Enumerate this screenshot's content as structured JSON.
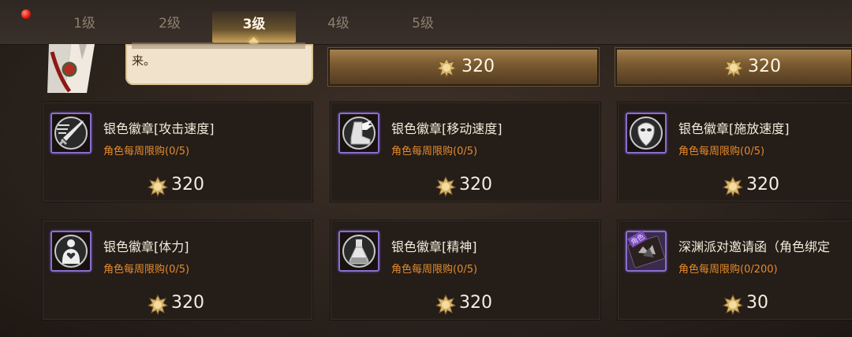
{
  "tabs": [
    {
      "label": "1级"
    },
    {
      "label": "2级"
    },
    {
      "label": "3级",
      "active": true
    },
    {
      "label": "4级"
    },
    {
      "label": "5级"
    }
  ],
  "top_row": {
    "speech_text": "来。",
    "prices": [
      "320",
      "320"
    ]
  },
  "items": [
    {
      "name": "银色徽章[攻击速度]",
      "limit": "角色每周限购(0/5)",
      "price": "320",
      "icon": "sword-speed-icon"
    },
    {
      "name": "银色徽章[移动速度]",
      "limit": "角色每周限购(0/5)",
      "price": "320",
      "icon": "winged-boot-icon"
    },
    {
      "name": "银色徽章[施放速度]",
      "limit": "角色每周限购(0/5)",
      "price": "320",
      "icon": "mask-icon"
    },
    {
      "name": "银色徽章[体力]",
      "limit": "角色每周限购(0/5)",
      "price": "320",
      "icon": "body-heart-icon"
    },
    {
      "name": "银色徽章[精神]",
      "limit": "角色每周限购(0/5)",
      "price": "320",
      "icon": "potion-flask-icon"
    },
    {
      "name": "深渊派对邀请函（角色绑定",
      "limit": "角色每周限购(0/200)",
      "price": "30",
      "icon": "invitation-card-icon",
      "icon_badge": "角色"
    }
  ],
  "colors": {
    "limit_text": "#e78a2c",
    "rare_border": "#8a6fcb",
    "notification": "#e2160c"
  }
}
